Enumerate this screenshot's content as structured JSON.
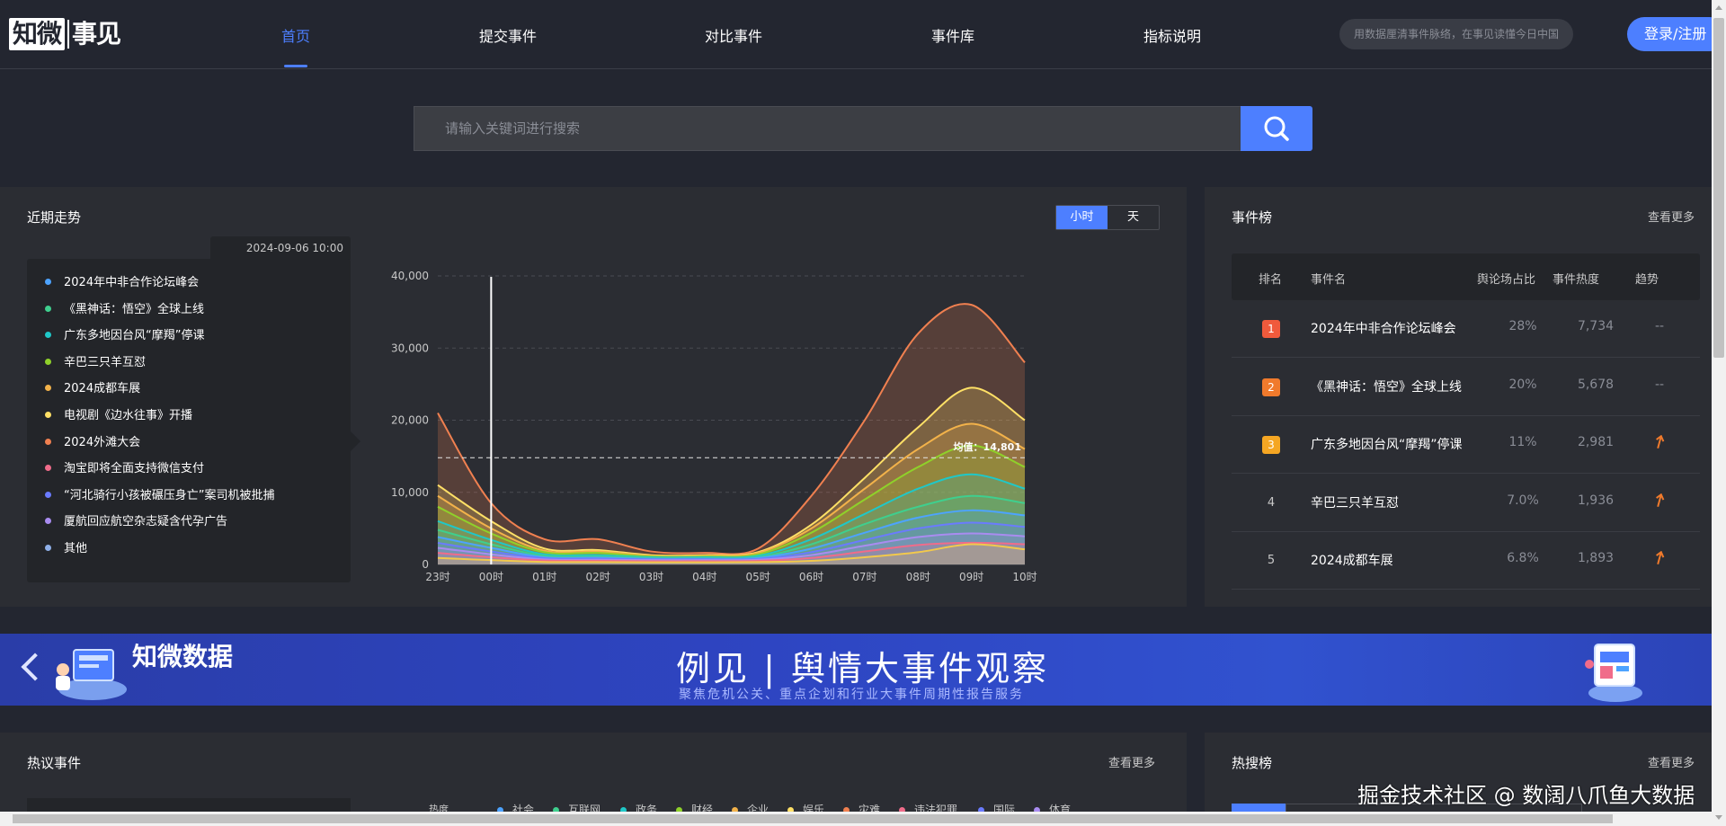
{
  "header": {
    "logo_main": "知微",
    "logo_sub": "事见",
    "nav": [
      {
        "label": "首页",
        "active": true
      },
      {
        "label": "提交事件"
      },
      {
        "label": "对比事件"
      },
      {
        "label": "事件库"
      },
      {
        "label": "指标说明"
      }
    ],
    "top_search_placeholder": "用数据厘清事件脉络，在事见读懂今日中国",
    "login_label": "登录/注册"
  },
  "search": {
    "placeholder": "请输入关键词进行搜索",
    "icon": "search-icon"
  },
  "trend": {
    "title": "近期走势",
    "toggle": [
      "小时",
      "天"
    ],
    "toggle_active": "小时",
    "tooltip_date": "2024-09-06 10:00",
    "legend": [
      {
        "name": "2024年中非合作论坛峰会",
        "color": "#4da3ff"
      },
      {
        "name": "《黑神话：悟空》全球上线",
        "color": "#3fcf8e"
      },
      {
        "name": "广东多地因台风“摩羯”停课",
        "color": "#1fc8c8"
      },
      {
        "name": "辛巴三只羊互怼",
        "color": "#8fd12a"
      },
      {
        "name": "2024成都车展",
        "color": "#f2b24a"
      },
      {
        "name": "电视剧《边水往事》开播",
        "color": "#ffe066"
      },
      {
        "name": "2024外滩大会",
        "color": "#f08050"
      },
      {
        "name": "淘宝即将全面支持微信支付",
        "color": "#f06c8a"
      },
      {
        "name": "“河北骑行小孩被碾压身亡”案司机被批捕",
        "color": "#6a7bff"
      },
      {
        "name": "厦航回应航空杂志疑含代孕广告",
        "color": "#a98cf0"
      },
      {
        "name": "其他",
        "color": "#8fb0e8"
      }
    ],
    "avg_label": "均值：14,801"
  },
  "chart_data": {
    "type": "area",
    "x": [
      "23时",
      "00时",
      "01时",
      "02时",
      "03时",
      "04时",
      "05时",
      "06时",
      "07时",
      "08时",
      "09时",
      "10时"
    ],
    "ylim": [
      0,
      40000
    ],
    "yticks": [
      "0",
      "10,000",
      "20,000",
      "30,000",
      "40,000"
    ],
    "average": 14801,
    "grid": true,
    "series": [
      {
        "name": "其他",
        "color": "#f08050",
        "values": [
          21000,
          8500,
          3500,
          3500,
          1800,
          1600,
          2200,
          9500,
          20000,
          32000,
          36000,
          28000
        ]
      },
      {
        "name": "电视剧《边水往事》开播",
        "color": "#ffe066",
        "values": [
          11000,
          6000,
          2200,
          2000,
          1300,
          1300,
          1700,
          5500,
          12000,
          19000,
          24500,
          20000
        ]
      },
      {
        "name": "2024成都车展",
        "color": "#f2b24a",
        "values": [
          9500,
          5000,
          1900,
          1800,
          1200,
          1200,
          1600,
          5000,
          10500,
          16000,
          19500,
          16000
        ]
      },
      {
        "name": "辛巴三只羊互怼",
        "color": "#8fd12a",
        "values": [
          8000,
          4300,
          1700,
          1600,
          1100,
          1100,
          1400,
          4400,
          9000,
          13500,
          16500,
          13500
        ]
      },
      {
        "name": "广东多地因台风“摩羯”停课",
        "color": "#1fc8c8",
        "values": [
          6000,
          3400,
          1400,
          1300,
          1000,
          1000,
          1200,
          3500,
          7000,
          10500,
          12500,
          10500
        ]
      },
      {
        "name": "《黑神话：悟空》全球上线",
        "color": "#3fcf8e",
        "values": [
          4800,
          2800,
          1200,
          1100,
          900,
          900,
          1000,
          2800,
          5600,
          8000,
          9500,
          8500
        ]
      },
      {
        "name": "2024年中非合作论坛峰会",
        "color": "#4da3ff",
        "values": [
          3800,
          2300,
          1000,
          950,
          800,
          800,
          900,
          2200,
          4400,
          6500,
          7500,
          6800
        ]
      },
      {
        "name": "“河北骑行小孩被碾压身亡”案司机被批捕",
        "color": "#6a7bff",
        "values": [
          3000,
          1800,
          850,
          800,
          700,
          700,
          750,
          1700,
          3400,
          5000,
          5800,
          5200
        ]
      },
      {
        "name": "厦航回应航空杂志疑含代孕广告",
        "color": "#a98cf0",
        "values": [
          2300,
          1400,
          700,
          650,
          600,
          600,
          650,
          1300,
          2600,
          3800,
          4300,
          3900
        ]
      },
      {
        "name": "淘宝即将全面支持微信支付",
        "color": "#f06c8a",
        "values": [
          1600,
          1000,
          550,
          500,
          450,
          450,
          500,
          900,
          1800,
          2700,
          3000,
          2800
        ]
      },
      {
        "name": "2024外滩大会",
        "color": "#f2c94c",
        "values": [
          900,
          600,
          350,
          330,
          300,
          300,
          330,
          500,
          1000,
          1700,
          2800,
          2100
        ]
      }
    ]
  },
  "ranking": {
    "title": "事件榜",
    "more": "查看更多",
    "columns": [
      "排名",
      "事件名",
      "舆论场占比",
      "事件热度",
      "趋势"
    ],
    "rows": [
      {
        "rank": "1",
        "name": "2024年中非合作论坛峰会",
        "share": "28%",
        "heat": "7,734",
        "trend": "--",
        "badge": "#f05a3c"
      },
      {
        "rank": "2",
        "name": "《黑神话：悟空》全球上线",
        "share": "20%",
        "heat": "5,678",
        "trend": "--",
        "badge": "#f07a2c"
      },
      {
        "rank": "3",
        "name": "广东多地因台风“摩羯”停课",
        "share": "11%",
        "heat": "2,981",
        "trend": "up",
        "badge": "#f5a623"
      },
      {
        "rank": "4",
        "name": "辛巴三只羊互怼",
        "share": "7.0%",
        "heat": "1,936",
        "trend": "up",
        "badge": ""
      },
      {
        "rank": "5",
        "name": "2024成都车展",
        "share": "6.8%",
        "heat": "1,893",
        "trend": "up",
        "badge": ""
      }
    ],
    "up_color": "#f07a2c"
  },
  "banner": {
    "brand": "知微数据",
    "title": "例见 | 舆情大事件观察",
    "subtitle": "聚焦危机公关、重点企划和行业大事件周期性报告服务"
  },
  "hot_events": {
    "title": "热议事件",
    "more": "查看更多",
    "heat_label": "热度",
    "categories": [
      {
        "name": "社会",
        "color": "#4da3ff"
      },
      {
        "name": "互联网",
        "color": "#3fcf8e"
      },
      {
        "name": "政务",
        "color": "#1fc8c8"
      },
      {
        "name": "财经",
        "color": "#8fd12a"
      },
      {
        "name": "企业",
        "color": "#f2b24a"
      },
      {
        "name": "娱乐",
        "color": "#ffe066"
      },
      {
        "name": "灾难",
        "color": "#f08050"
      },
      {
        "name": "违法犯罪",
        "color": "#f06c8a"
      },
      {
        "name": "国际",
        "color": "#6a7bff"
      },
      {
        "name": "体育",
        "color": "#a98cf0"
      }
    ]
  },
  "hot_search": {
    "title": "热搜榜",
    "more": "查看更多"
  },
  "watermark": "掘金技术社区 @ 数阔八爪鱼大数据"
}
